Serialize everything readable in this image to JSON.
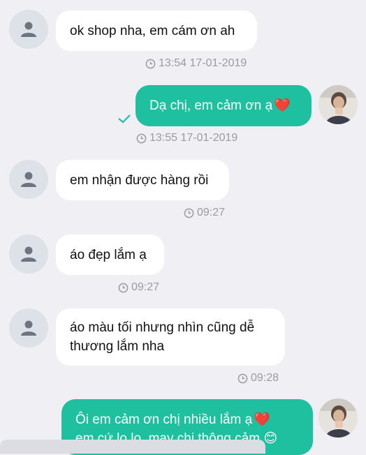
{
  "messages": [
    {
      "direction": "incoming",
      "text": "ok shop nha, em cám ơn ah",
      "time": "13:54 17-01-2019"
    },
    {
      "direction": "outgoing",
      "text": "Dạ chị, em cảm ơn ạ",
      "emoji": "❤️",
      "time": "13:55 17-01-2019",
      "status": "delivered"
    },
    {
      "direction": "incoming",
      "text": "em nhận được hàng rồi",
      "time": "09:27"
    },
    {
      "direction": "incoming",
      "text": "áo đẹp lắm ạ",
      "time": "09:27"
    },
    {
      "direction": "incoming",
      "lines": [
        "áo màu tối nhưng nhìn cũng dễ",
        "thương lắm nha"
      ],
      "time": "09:28"
    },
    {
      "direction": "outgoing",
      "lines": [
        "Ôi em cảm ơn chị nhiều lắm ạ",
        "em cứ lo lo, may chị thông cảm"
      ],
      "emoji": "❤️",
      "emoji2": "😊"
    }
  ],
  "icons": {
    "default_avatar": "person-icon",
    "clock": "clock-icon",
    "check": "check-icon"
  },
  "colors": {
    "background": "#efeff4",
    "outgoing_bubble": "#1fc0a0",
    "incoming_bubble": "#ffffff",
    "timestamp": "#9a9ba0",
    "heart": "#e52b2b"
  }
}
